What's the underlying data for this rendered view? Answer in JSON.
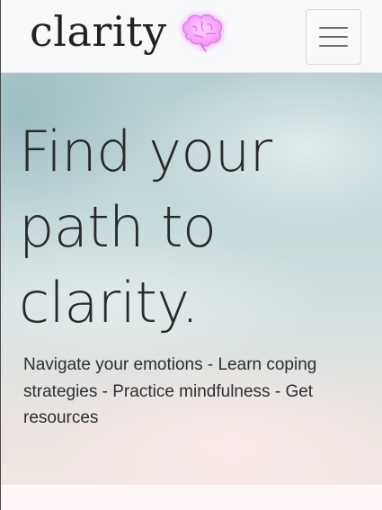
{
  "navbar": {
    "brand_text": "clarity",
    "brand_icon": "brain-icon",
    "brand_icon_color": "#f3a6ff",
    "toggler_icon": "hamburger-menu-icon"
  },
  "hero": {
    "title": "Find your path to clarity.",
    "subtitle": "Navigate your emotions - Learn coping strategies - Practice mindfulness - Get resources"
  },
  "colors": {
    "navbar_bg": "#f8f9fa",
    "text": "#2a2a2a",
    "bottom_section_bg": "#fff6f7"
  }
}
